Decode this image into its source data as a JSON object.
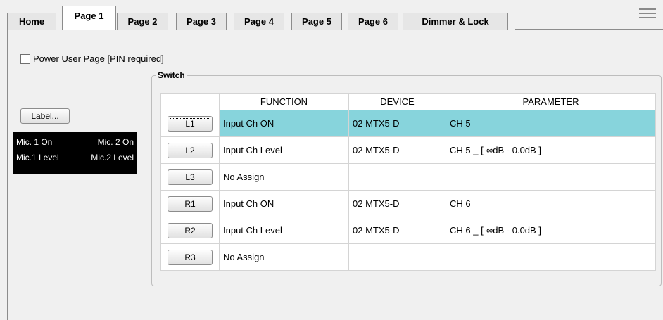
{
  "tabs": [
    {
      "label": "Home",
      "active": false
    },
    {
      "label": "Page 1",
      "active": true
    },
    {
      "label": "Page 2",
      "active": false
    },
    {
      "label": "Page 3",
      "active": false
    },
    {
      "label": "Page 4",
      "active": false
    },
    {
      "label": "Page 5",
      "active": false
    },
    {
      "label": "Page 6",
      "active": false
    },
    {
      "label": "Dimmer & Lock",
      "active": false
    }
  ],
  "menu_icon": "hamburger-menu-icon",
  "power_user": {
    "label": "Power User Page [PIN required]",
    "checked": false
  },
  "label_button": "Label...",
  "lcd": {
    "top_left": "Mic. 1 On",
    "top_right": "Mic. 2 On",
    "bottom_left": "Mic.1 Level",
    "bottom_right": "Mic.2 Level"
  },
  "switch_group": {
    "title": "Switch",
    "headers": {
      "button": "",
      "function": "FUNCTION",
      "device": "DEVICE",
      "parameter": "PARAMETER"
    },
    "rows": [
      {
        "button": "L1",
        "function": "Input Ch ON",
        "device": "02 MTX5-D",
        "parameter": "CH 5",
        "selected": true
      },
      {
        "button": "L2",
        "function": "Input Ch Level",
        "device": "02 MTX5-D",
        "parameter": "CH 5 _ [-∞dB - 0.0dB ]",
        "selected": false
      },
      {
        "button": "L3",
        "function": "No Assign",
        "device": "",
        "parameter": "",
        "selected": false
      },
      {
        "button": "R1",
        "function": "Input Ch ON",
        "device": "02 MTX5-D",
        "parameter": "CH 6",
        "selected": false
      },
      {
        "button": "R2",
        "function": "Input Ch Level",
        "device": "02 MTX5-D",
        "parameter": "CH 6 _ [-∞dB - 0.0dB ]",
        "selected": false
      },
      {
        "button": "R3",
        "function": "No Assign",
        "device": "",
        "parameter": "",
        "selected": false
      }
    ]
  },
  "colors": {
    "selected_row": "#87d4dc"
  }
}
